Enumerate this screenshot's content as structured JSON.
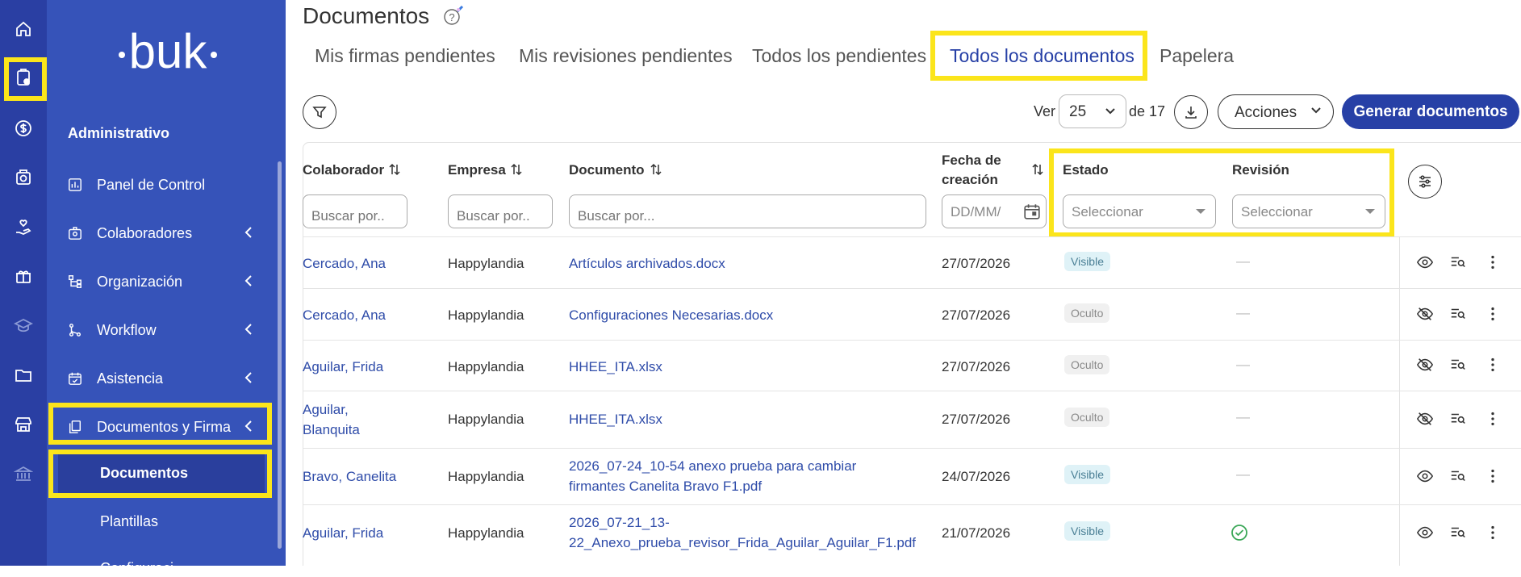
{
  "rail": {
    "icons": [
      "home-icon",
      "clipboard-clock-icon",
      "dollar-circle-icon",
      "camera-icon",
      "hand-heart-icon",
      "gift-icon",
      "graduation-cap-icon",
      "folder-icon",
      "store-icon",
      "bank-icon"
    ]
  },
  "sidebar": {
    "brand": "buk",
    "section_title": "Administrativo",
    "items": [
      {
        "label": "Panel de Control",
        "icon": "bar-chart-icon"
      },
      {
        "label": "Colaboradores",
        "icon": "id-card-icon"
      },
      {
        "label": "Organización",
        "icon": "org-chart-icon"
      },
      {
        "label": "Workflow",
        "icon": "workflow-icon"
      },
      {
        "label": "Asistencia",
        "icon": "calendar-check-icon"
      },
      {
        "label": "Documentos y Firma",
        "icon": "documents-icon"
      }
    ],
    "subitems": [
      {
        "label": "Documentos"
      },
      {
        "label": "Plantillas"
      },
      {
        "label": "Configuraci"
      }
    ]
  },
  "header": {
    "title": "Documentos"
  },
  "tabs": [
    {
      "label": "Mis firmas pendientes"
    },
    {
      "label": "Mis revisiones pendientes"
    },
    {
      "label": "Todos los pendientes"
    },
    {
      "label": "Todos los documentos"
    },
    {
      "label": "Papelera"
    }
  ],
  "toolbar": {
    "ver_label": "Ver",
    "per_page": "25",
    "de_label": "de 17",
    "acciones_label": "Acciones",
    "generar_label": "Generar documentos"
  },
  "table": {
    "headers": {
      "colaborador": "Colaborador",
      "empresa": "Empresa",
      "documento": "Documento",
      "fecha_l1": "Fecha de",
      "fecha_l2": "creación",
      "estado": "Estado",
      "revision": "Revisión"
    },
    "filters": {
      "colaborador_ph": "Buscar por..",
      "empresa_ph": "Buscar por..",
      "documento_ph": "Buscar por...",
      "fecha_ph": "DD/MM/",
      "estado_ph": "Seleccionar",
      "revision_ph": "Seleccionar"
    },
    "rows": [
      {
        "colaborador": "Cercado, Ana",
        "colaborador_l2": "",
        "empresa": "Happylandia",
        "documento": "Artículos archivados.docx",
        "documento_l2": "",
        "fecha": "27/07/2026",
        "estado": "Visible",
        "revision": "—"
      },
      {
        "colaborador": "Cercado, Ana",
        "colaborador_l2": "",
        "empresa": "Happylandia",
        "documento": "Configuraciones Necesarias.docx",
        "documento_l2": "",
        "fecha": "27/07/2026",
        "estado": "Oculto",
        "revision": "—"
      },
      {
        "colaborador": "Aguilar, Frida",
        "colaborador_l2": "",
        "empresa": "Happylandia",
        "documento": "HHEE_ITA.xlsx",
        "documento_l2": "",
        "fecha": "27/07/2026",
        "estado": "Oculto",
        "revision": "—"
      },
      {
        "colaborador": "Aguilar,",
        "colaborador_l2": "Blanquita",
        "empresa": "Happylandia",
        "documento": "HHEE_ITA.xlsx",
        "documento_l2": "",
        "fecha": "27/07/2026",
        "estado": "Oculto",
        "revision": "—"
      },
      {
        "colaborador": "Bravo, Canelita",
        "colaborador_l2": "",
        "empresa": "Happylandia",
        "documento": "2026_07-24_10-54 anexo prueba para cambiar",
        "documento_l2": "firmantes Canelita Bravo F1.pdf",
        "fecha": "24/07/2026",
        "estado": "Visible",
        "revision": "—"
      },
      {
        "colaborador": "Aguilar, Frida",
        "colaborador_l2": "",
        "empresa": "Happylandia",
        "documento": "2026_07-21_13-",
        "documento_l2": "22_Anexo_prueba_revisor_Frida_Aguilar_Aguilar_F1.pdf",
        "fecha": "21/07/2026",
        "estado": "Visible",
        "revision": "check"
      }
    ]
  },
  "colors": {
    "rail_bg": "#2a3fa3",
    "sidebar_bg": "#3653b9",
    "accent": "#2740a6",
    "highlight": "#fbe51b",
    "link": "#2f4ca9"
  }
}
